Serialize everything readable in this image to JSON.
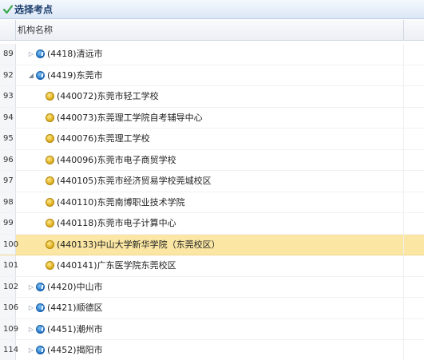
{
  "title": "选择考点",
  "column_header": "机构名称",
  "rows": [
    {
      "num": "89",
      "label": "(4418)清远市",
      "type": "city",
      "expanded": false,
      "selected": false
    },
    {
      "num": "92",
      "label": "(4419)东莞市",
      "type": "city",
      "expanded": true,
      "selected": false
    },
    {
      "num": "93",
      "label": "(440072)东莞市轻工学校",
      "type": "site",
      "selected": false
    },
    {
      "num": "94",
      "label": "(440073)东莞理工学院自考辅导中心",
      "type": "site",
      "selected": false
    },
    {
      "num": "95",
      "label": "(440076)东莞理工学校",
      "type": "site",
      "selected": false
    },
    {
      "num": "96",
      "label": "(440096)东莞市电子商贸学校",
      "type": "site",
      "selected": false
    },
    {
      "num": "97",
      "label": "(440105)东莞市经济贸易学校莞城校区",
      "type": "site",
      "selected": false
    },
    {
      "num": "98",
      "label": "(440110)东莞南博职业技术学院",
      "type": "site",
      "selected": false
    },
    {
      "num": "99",
      "label": "(440118)东莞市电子计算中心",
      "type": "site",
      "selected": false
    },
    {
      "num": "100",
      "label": "(440133)中山大学新华学院（东莞校区）",
      "type": "site",
      "selected": true
    },
    {
      "num": "101",
      "label": "(440141)广东医学院东莞校区",
      "type": "site",
      "selected": false
    },
    {
      "num": "102",
      "label": "(4420)中山市",
      "type": "city",
      "expanded": false,
      "selected": false
    },
    {
      "num": "106",
      "label": "(4421)顺德区",
      "type": "city",
      "expanded": false,
      "selected": false
    },
    {
      "num": "109",
      "label": "(4451)潮州市",
      "type": "city",
      "expanded": false,
      "selected": false
    },
    {
      "num": "114",
      "label": "(4452)揭阳市",
      "type": "city",
      "expanded": false,
      "selected": false
    }
  ],
  "colors": {
    "selected_row": "#fbe7a3",
    "title_text": "#1a3c6b",
    "city_icon": "#1d6fc4",
    "site_icon": "#d9a814"
  }
}
